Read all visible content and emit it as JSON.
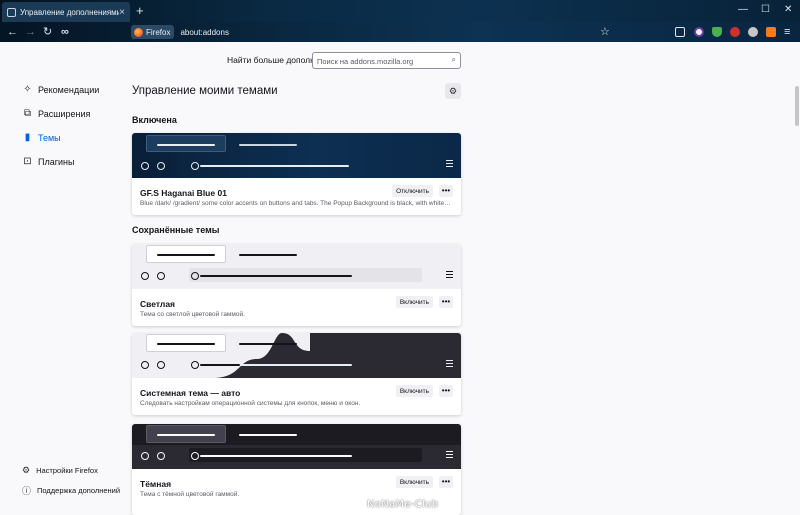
{
  "browser": {
    "tab_title": "Управление дополнениями",
    "identity_label": "Firefox",
    "url": "about:addons"
  },
  "sidebar": {
    "categories": [
      {
        "label": "Рекомендации"
      },
      {
        "label": "Расширения"
      },
      {
        "label": "Темы",
        "selected": true
      },
      {
        "label": "Плагины"
      }
    ],
    "footer": [
      {
        "label": "Настройки Firefox"
      },
      {
        "label": "Поддержка дополнений"
      }
    ]
  },
  "header": {
    "find_more_label": "Найти больше дополнений",
    "search_placeholder": "Поиск на addons.mozilla.org"
  },
  "main": {
    "heading": "Управление моими темами",
    "enabled_section": "Включена",
    "saved_section": "Сохранённые темы",
    "themes": [
      {
        "name": "GF.S Haganai Blue 01",
        "description": "Blue /dark/ /gradient/ some color accents on buttons and tabs. The Popup Background is black, with white text",
        "action_label": "Отключить",
        "more_label": "•••",
        "preview_bg": "#0b2440",
        "preview_accent": "#0f3358"
      },
      {
        "name": "Светлая",
        "description": "Тема со светлой цветовой гаммой.",
        "action_label": "Включить",
        "more_label": "•••",
        "preview_bg": "#f0f0f4"
      },
      {
        "name": "Системная тема — авто",
        "description": "Следовать настройкам операционной системы для кнопок, меню и окон.",
        "action_label": "Включить",
        "more_label": "•••",
        "preview_bg": "#f0f0f4",
        "preview_dark": "#2b2a33"
      },
      {
        "name": "Тёмная",
        "description": "Тема с тёмной цветовой гаммой.",
        "action_label": "Включить",
        "more_label": "•••",
        "preview_bg": "#2b2a33"
      }
    ]
  },
  "watermark": "NoNaMe-Club",
  "colors": {
    "accent": "#0061e0",
    "page_bg": "#f9f9fb"
  }
}
